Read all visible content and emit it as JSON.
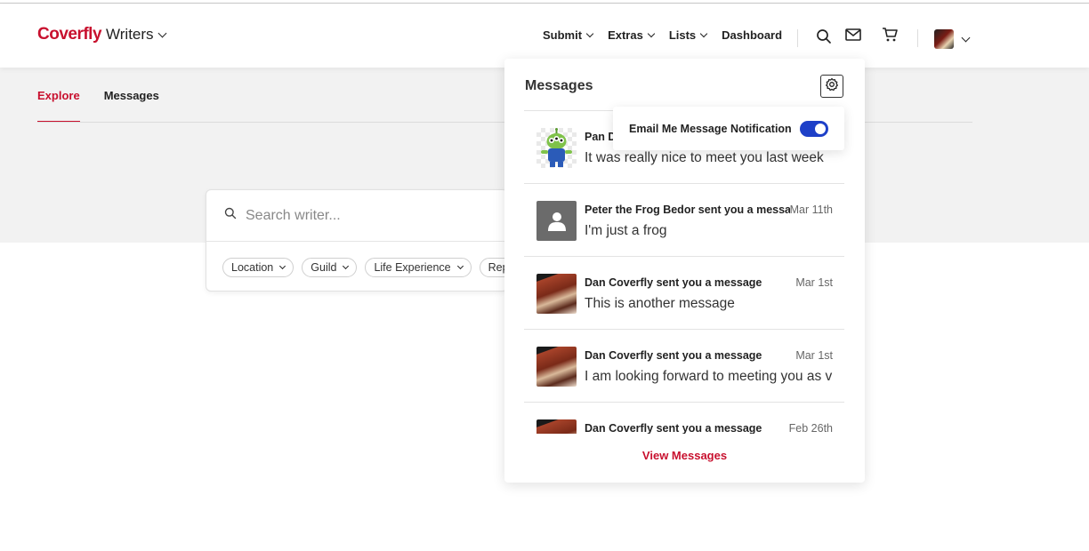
{
  "brand": {
    "name": "Coverfly",
    "product": "Writers"
  },
  "nav": {
    "items": [
      {
        "label": "Submit",
        "dropdown": true
      },
      {
        "label": "Extras",
        "dropdown": true
      },
      {
        "label": "Lists",
        "dropdown": true
      },
      {
        "label": "Dashboard",
        "dropdown": false
      }
    ],
    "icons": [
      "search-icon",
      "mail-icon",
      "cart-icon"
    ]
  },
  "tabs": [
    {
      "label": "Explore",
      "active": true
    },
    {
      "label": "Messages",
      "active": false
    }
  ],
  "search": {
    "placeholder": "Search writer...",
    "filters": [
      {
        "label": "Location"
      },
      {
        "label": "Guild"
      },
      {
        "label": "Life Experience"
      },
      {
        "label": "Rep"
      }
    ]
  },
  "messages_panel": {
    "title": "Messages",
    "notification_toggle": {
      "label": "Email Me Message Notification",
      "enabled": true
    },
    "items": [
      {
        "sender": "Pan D",
        "date": "",
        "preview": "It was really nice to meet you last week",
        "avatar": "alien"
      },
      {
        "sender": "Peter the Frog Bedor sent you a message",
        "date": "Mar 11th",
        "preview": "I'm just a frog",
        "avatar": "default"
      },
      {
        "sender": "Dan Coverfly sent you a message",
        "date": "Mar 1st",
        "preview": "This is another message",
        "avatar": "guitar"
      },
      {
        "sender": "Dan Coverfly sent you a message",
        "date": "Mar 1st",
        "preview": "I am looking forward to meeting you as v",
        "avatar": "guitar"
      },
      {
        "sender": "Dan Coverfly sent you a message",
        "date": "Feb 26th",
        "preview": "",
        "avatar": "guitar"
      }
    ],
    "view_all_label": "View Messages"
  },
  "colors": {
    "brand": "#c8102e",
    "toggle": "#1e40c8",
    "band": "#f2f2f2"
  }
}
